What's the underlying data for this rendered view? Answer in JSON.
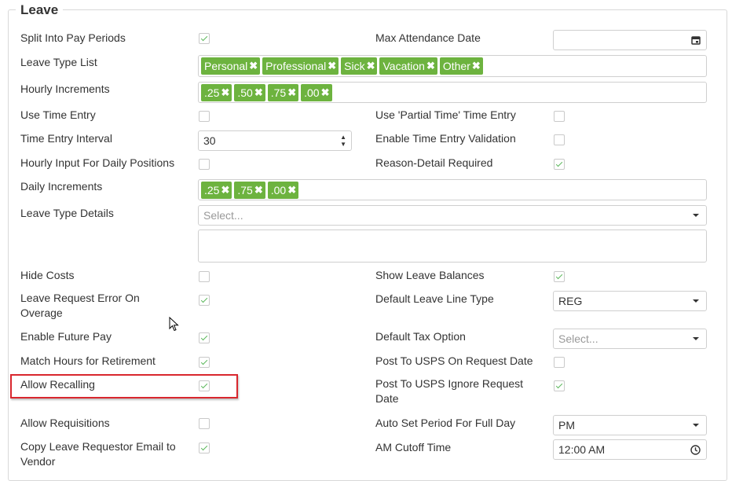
{
  "section": {
    "title": "Leave"
  },
  "left": {
    "split_pay_periods": "Split Into Pay Periods",
    "leave_type_list": "Leave Type List",
    "hourly_increments": "Hourly Increments",
    "use_time_entry": "Use Time Entry",
    "time_entry_interval": "Time Entry Interval",
    "hourly_input_daily": "Hourly Input For Daily Positions",
    "daily_increments": "Daily Increments",
    "leave_type_details": "Leave Type Details",
    "hide_costs": "Hide Costs",
    "leave_request_error_line1": "Leave Request Error On",
    "leave_request_error_line2": "Overage",
    "enable_future_pay": "Enable Future Pay",
    "match_hours_retirement": "Match Hours for Retirement",
    "allow_recalling": "Allow Recalling",
    "allow_requisitions": "Allow Requisitions",
    "copy_email_line1": "Copy Leave Requestor Email to",
    "copy_email_line2": "Vendor"
  },
  "right": {
    "max_attendance_date": "Max Attendance Date",
    "use_partial_time": "Use 'Partial Time' Time Entry",
    "enable_validation": "Enable Time Entry Validation",
    "reason_detail_required": "Reason-Detail Required",
    "show_leave_balances": "Show Leave Balances",
    "default_leave_line_type": "Default Leave Line Type",
    "default_tax_option": "Default Tax Option",
    "post_usps_on_request": "Post To USPS On Request Date",
    "post_usps_ignore_line1": "Post To USPS Ignore Request",
    "post_usps_ignore_line2": "Date",
    "auto_set_period": "Auto Set Period For Full Day",
    "am_cutoff_time": "AM Cutoff Time"
  },
  "leave_types": [
    "Personal",
    "Professional",
    "Sick",
    "Vacation",
    "Other"
  ],
  "hourly_increments": [
    ".25",
    ".50",
    ".75",
    ".00"
  ],
  "daily_increments": [
    ".25",
    ".75",
    ".00"
  ],
  "values": {
    "time_entry_interval": "30",
    "leave_type_details_placeholder": "Select...",
    "default_leave_line_type": "REG",
    "default_tax_option_placeholder": "Select...",
    "auto_set_period": "PM",
    "am_cutoff_time": "12:00 AM",
    "max_attendance_date": ""
  },
  "checkboxes": {
    "split_pay_periods": true,
    "use_time_entry": false,
    "use_partial_time": false,
    "enable_validation": false,
    "hourly_input_daily": false,
    "reason_detail_required": true,
    "hide_costs": false,
    "show_leave_balances": true,
    "leave_request_error": true,
    "enable_future_pay": true,
    "match_hours_retirement": true,
    "post_usps_on_request": false,
    "allow_recalling": true,
    "post_usps_ignore": true,
    "allow_requisitions": false,
    "copy_email": true
  },
  "colors": {
    "tag_green": "#6db33f",
    "check_green": "#5cb85c",
    "highlight_red": "#d9272e"
  },
  "icons": {
    "tag_remove": "x-icon",
    "date": "calendar-icon",
    "time": "clock-icon",
    "dropdown": "caret-down-icon"
  }
}
